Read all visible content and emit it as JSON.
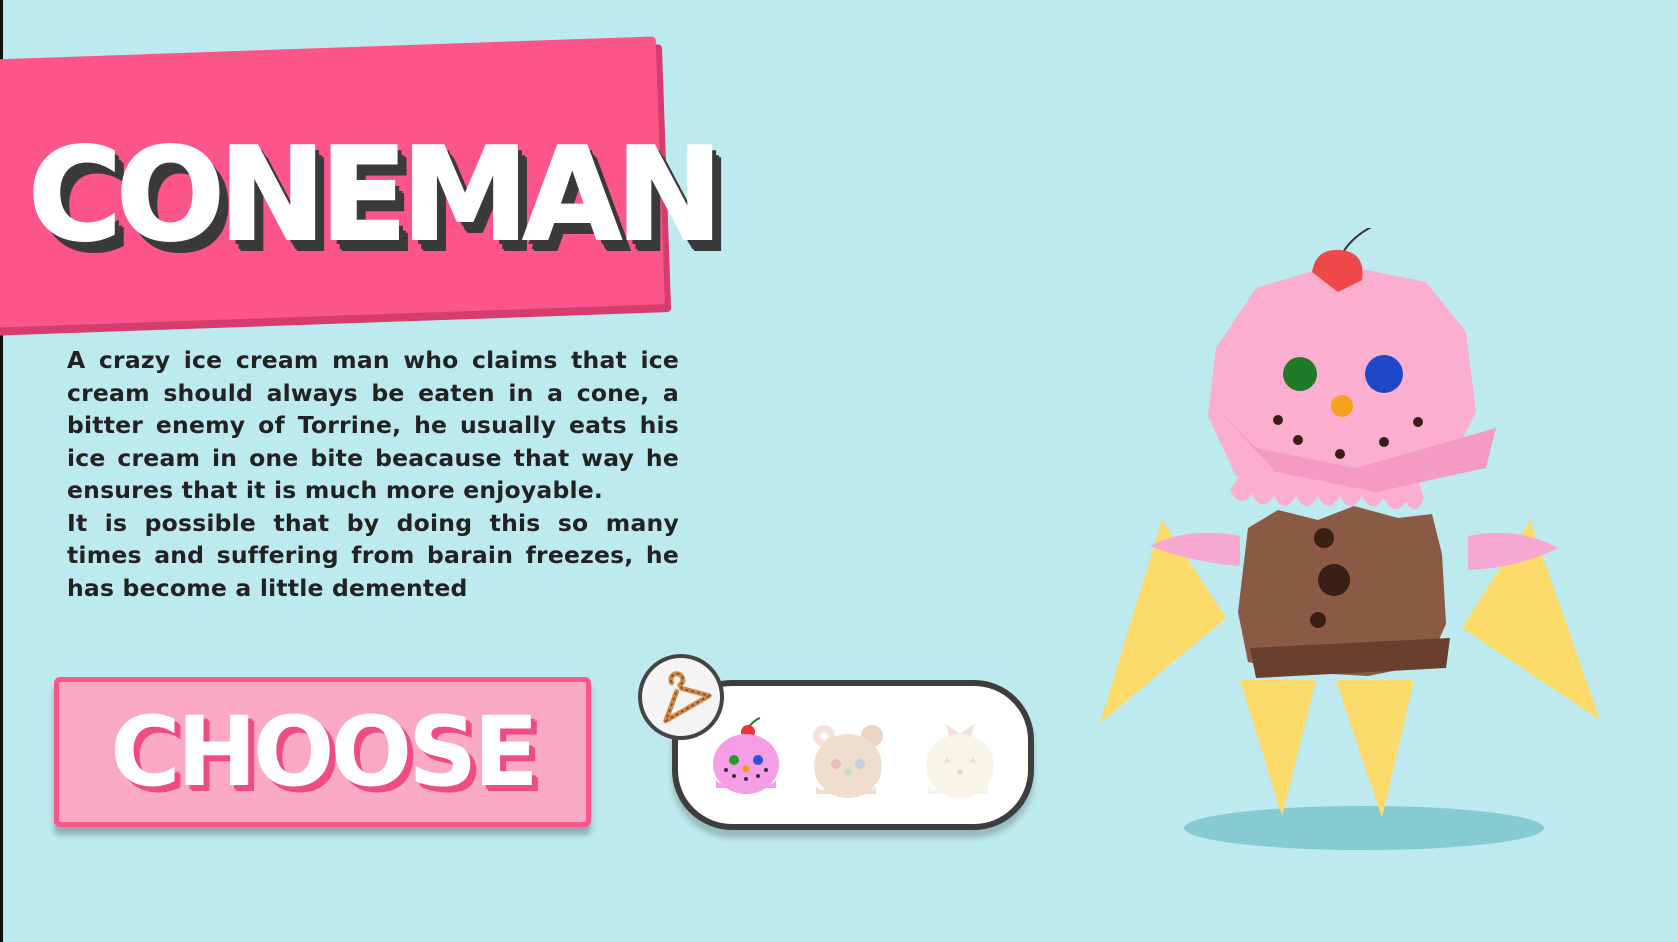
{
  "character": {
    "name": "CONEMAN",
    "description": [
      "A crazy ice cream man who claims that ice cream should always be eaten in a cone, a bitter enemy of Torrine, he usually eats his ice cream in one bite beacause that way he ensures that it is much more enjoyable.",
      "It is possible that by doing this so many times and suffering from barain freezes, he has become a little demented"
    ]
  },
  "choose_button": {
    "label": "CHOOSE"
  },
  "skins": {
    "selected_index": 0,
    "items": [
      {
        "icon": "pink-cherry-scoop-skin-icon",
        "state": "selected"
      },
      {
        "icon": "donut-bear-skin-icon",
        "state": "locked"
      },
      {
        "icon": "cream-bow-skin-icon",
        "state": "locked"
      }
    ],
    "wardrobe_icon": "hanger-icon"
  },
  "colors": {
    "background": "#bdeaee",
    "banner": "#fb5589",
    "button_fill": "#f9a9c4",
    "scoop_pink": "#fbaecd",
    "cone_yellow": "#fddb6b",
    "chocolate": "#8b5a44"
  }
}
